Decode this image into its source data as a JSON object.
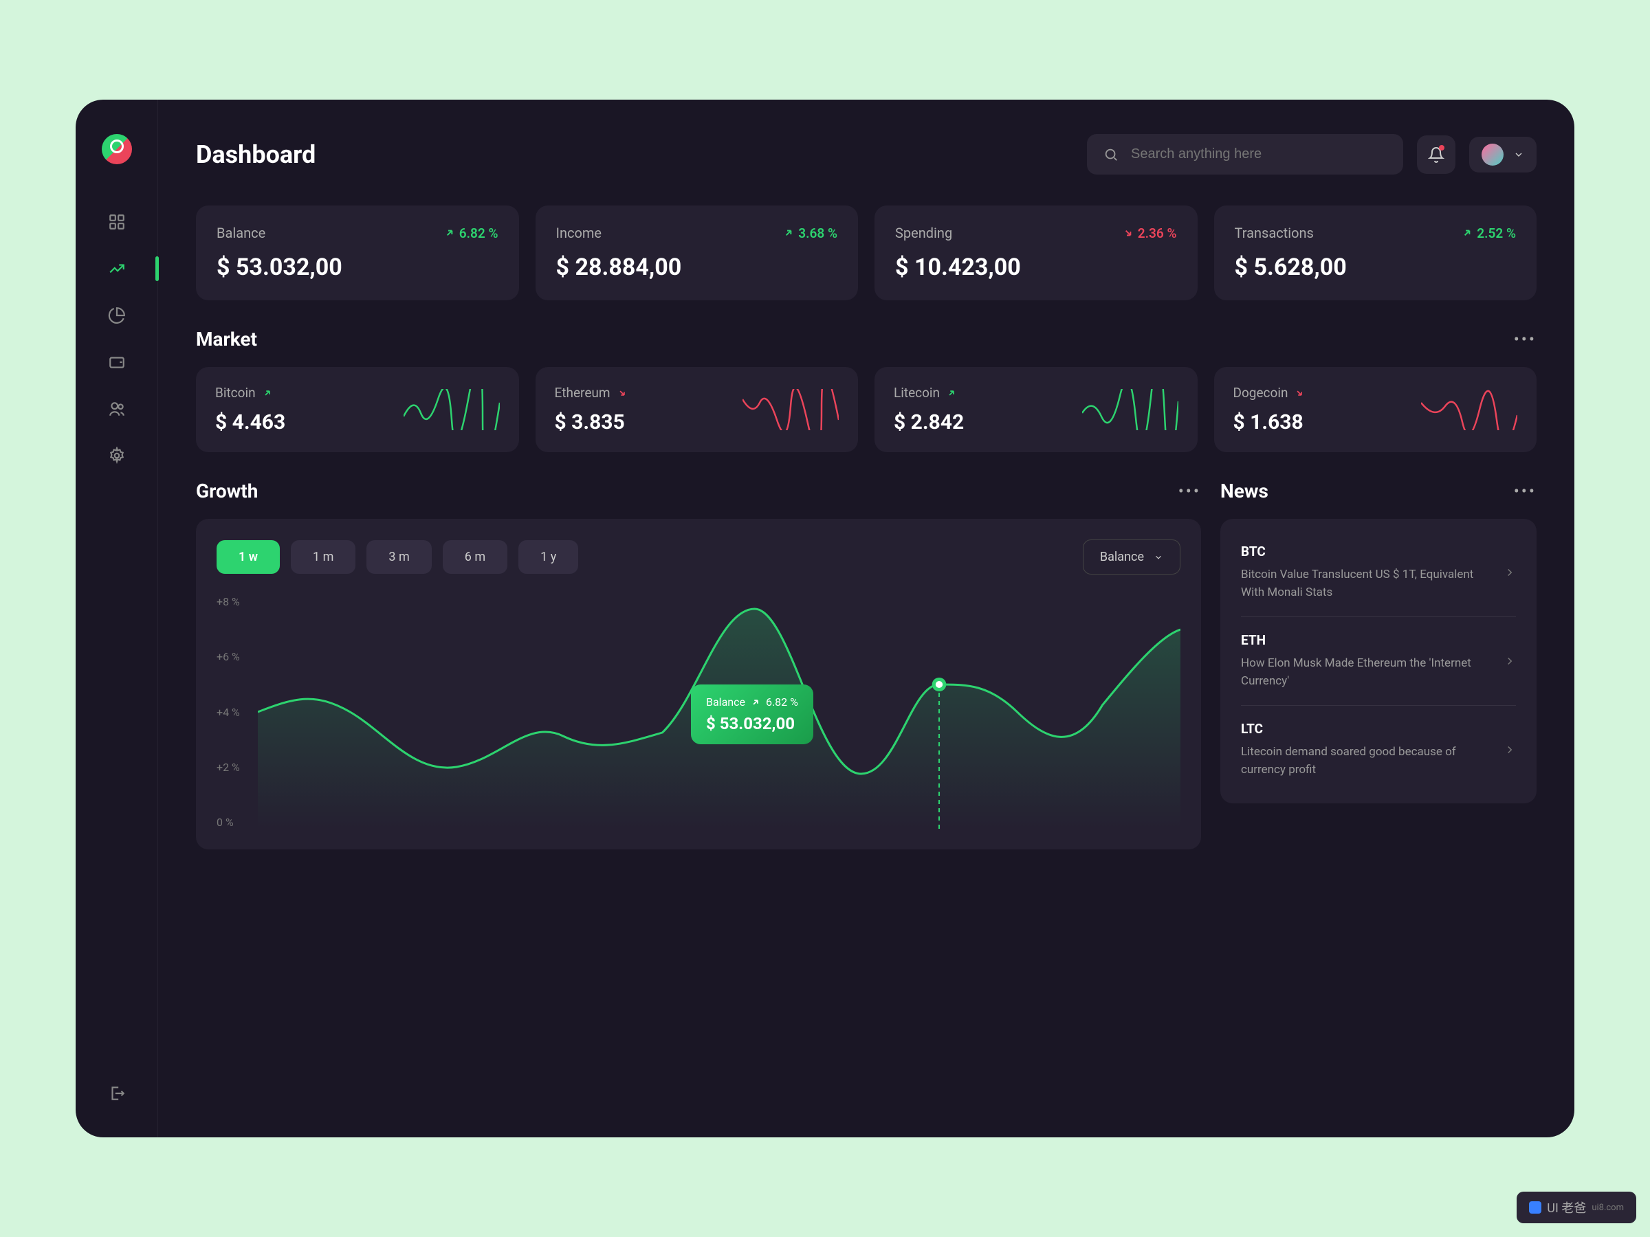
{
  "header": {
    "title": "Dashboard",
    "search_placeholder": "Search anything here"
  },
  "stats": [
    {
      "label": "Balance",
      "value": "$ 53.032,00",
      "change": "6.82 %",
      "dir": "up"
    },
    {
      "label": "Income",
      "value": "$ 28.884,00",
      "change": "3.68 %",
      "dir": "up"
    },
    {
      "label": "Spending",
      "value": "$ 10.423,00",
      "change": "2.36 %",
      "dir": "down"
    },
    {
      "label": "Transactions",
      "value": "$ 5.628,00",
      "change": "2.52 %",
      "dir": "up"
    }
  ],
  "market": {
    "title": "Market",
    "items": [
      {
        "name": "Bitcoin",
        "value": "$ 4.463",
        "dir": "up"
      },
      {
        "name": "Ethereum",
        "value": "$ 3.835",
        "dir": "down"
      },
      {
        "name": "Litecoin",
        "value": "$ 2.842",
        "dir": "up"
      },
      {
        "name": "Dogecoin",
        "value": "$ 1.638",
        "dir": "down"
      }
    ]
  },
  "growth": {
    "title": "Growth",
    "periods": [
      "1 w",
      "1 m",
      "3 m",
      "6 m",
      "1 y"
    ],
    "active_period": 0,
    "selector": "Balance",
    "ylabels": [
      "+8 %",
      "+6 %",
      "+4 %",
      "+2 %",
      "0 %"
    ],
    "tooltip": {
      "label": "Balance",
      "change": "6.82 %",
      "value": "$ 53.032,00"
    }
  },
  "news": {
    "title": "News",
    "items": [
      {
        "ticker": "BTC",
        "text": "Bitcoin Value Translucent US $ 1T, Equivalent With Monali Stats"
      },
      {
        "ticker": "ETH",
        "text": "How Elon Musk Made Ethereum the 'Internet Currency'"
      },
      {
        "ticker": "LTC",
        "text": "Litecoin demand soared good because of currency profit"
      }
    ]
  },
  "watermark": "UI 老爸",
  "watermark_sub": "ui8.com",
  "chart_data": {
    "type": "line",
    "title": "Growth",
    "ylabel": "%",
    "ylim": [
      0,
      8
    ],
    "x": [
      0,
      1,
      2,
      3,
      4,
      5,
      6,
      7,
      8,
      9,
      10,
      11,
      12,
      13
    ],
    "values": [
      4.0,
      4.5,
      3.0,
      2.5,
      4.0,
      3.0,
      3.5,
      8.0,
      2.0,
      5.0,
      5.0,
      3.0,
      6.0,
      7.0
    ],
    "highlight": {
      "index": 9,
      "label": "Balance",
      "change": 6.82,
      "value": 53032.0
    }
  }
}
